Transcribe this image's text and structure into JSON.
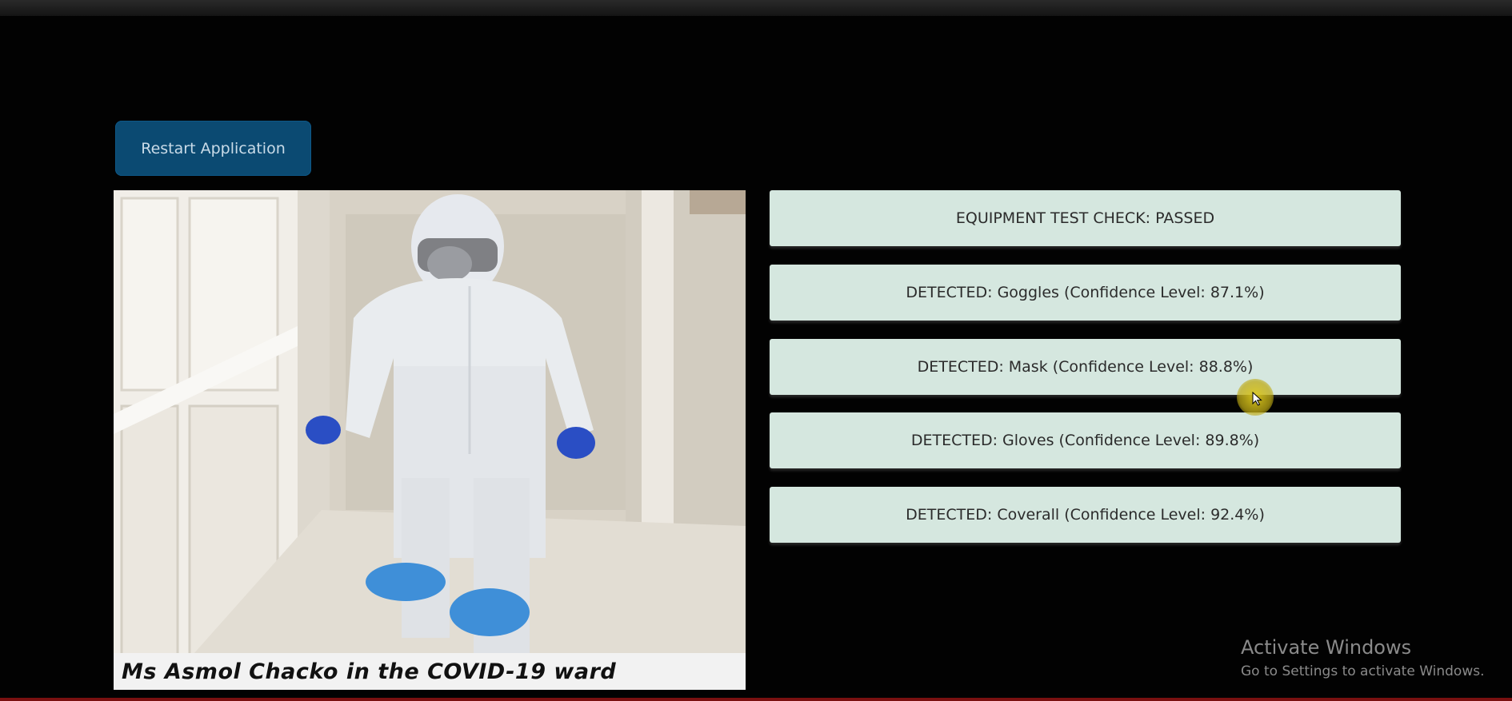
{
  "toolbar": {
    "restart_label": "Restart Application"
  },
  "photo": {
    "caption": "Ms Asmol Chacko in the COVID-19 ward"
  },
  "results": [
    {
      "text": "EQUIPMENT TEST CHECK: PASSED"
    },
    {
      "text": "DETECTED: Goggles (Confidence Level: 87.1%)"
    },
    {
      "text": "DETECTED: Mask (Confidence Level: 88.8%)"
    },
    {
      "text": "DETECTED: Gloves (Confidence Level: 89.8%)"
    },
    {
      "text": "DETECTED: Coverall (Confidence Level: 92.4%)"
    }
  ],
  "watermark": {
    "title": "Activate Windows",
    "subtitle": "Go to Settings to activate Windows."
  },
  "colors": {
    "background": "#020202",
    "button": "#0b4a72",
    "result_box": "#d5e7df"
  }
}
